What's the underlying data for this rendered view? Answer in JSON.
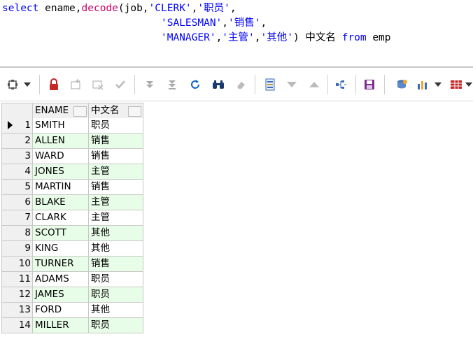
{
  "sql": {
    "line1": {
      "kw_select": "select",
      "ident": " ename,",
      "fn_decode": "decode",
      "open": "(job,",
      "s1": "'CLERK'",
      "c1": ",",
      "s2": "'职员'",
      "c2": ","
    },
    "line2": {
      "indent": "                          ",
      "s3": "'SALESMAN'",
      "c3": ",",
      "s4": "'销售'",
      "c4": ","
    },
    "line3": {
      "indent": "                          ",
      "s5": "'MANAGER'",
      "c5": ",",
      "s6": "'主管'",
      "c6": ",",
      "s7": "'其他'",
      "close": ") 中文名 ",
      "kw_from": "from",
      "tail": " emp"
    }
  },
  "toolbar": {
    "icons": [
      "query-options-icon",
      "dropdown-arrow-icon",
      "lock-icon",
      "insert-record-icon",
      "delete-record-icon",
      "post-changes-icon",
      "next-page-icon",
      "last-page-icon",
      "refresh-icon",
      "find-icon",
      "clear-icon",
      "record-view-icon",
      "sort-desc-icon",
      "sort-asc-icon",
      "query-by-example-icon",
      "save-icon",
      "export-icon",
      "chart-icon",
      "dropdown-arrow-icon-2",
      "table-view-icon",
      "dropdown-arrow-icon-3"
    ]
  },
  "grid": {
    "columns": [
      "ENAME",
      "中文名"
    ],
    "rows": [
      {
        "n": "1",
        "ename": "SMITH",
        "cn": "职员"
      },
      {
        "n": "2",
        "ename": "ALLEN",
        "cn": "销售"
      },
      {
        "n": "3",
        "ename": "WARD",
        "cn": "销售"
      },
      {
        "n": "4",
        "ename": "JONES",
        "cn": "主管"
      },
      {
        "n": "5",
        "ename": "MARTIN",
        "cn": "销售"
      },
      {
        "n": "6",
        "ename": "BLAKE",
        "cn": "主管"
      },
      {
        "n": "7",
        "ename": "CLARK",
        "cn": "主管"
      },
      {
        "n": "8",
        "ename": "SCOTT",
        "cn": "其他"
      },
      {
        "n": "9",
        "ename": "KING",
        "cn": "其他"
      },
      {
        "n": "10",
        "ename": "TURNER",
        "cn": "销售"
      },
      {
        "n": "11",
        "ename": "ADAMS",
        "cn": "职员"
      },
      {
        "n": "12",
        "ename": "JAMES",
        "cn": "职员"
      },
      {
        "n": "13",
        "ename": "FORD",
        "cn": "其他"
      },
      {
        "n": "14",
        "ename": "MILLER",
        "cn": "职员"
      }
    ]
  },
  "colors": {
    "keyword": "#0000ff",
    "function": "#cc0066",
    "alt_row": "#e8fde8",
    "grid_line": "#c8c8c8"
  }
}
